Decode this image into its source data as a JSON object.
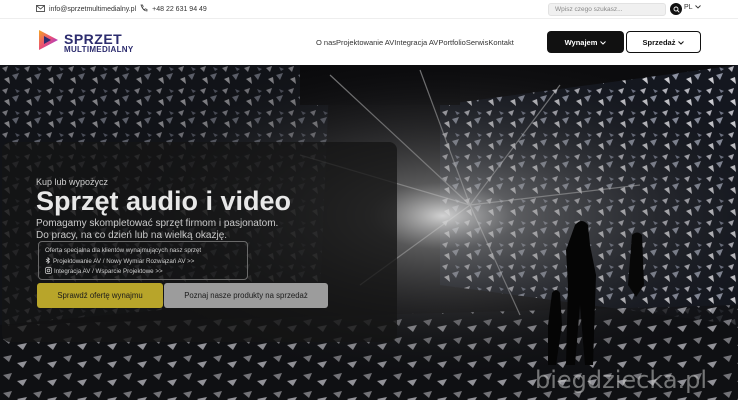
{
  "topbar": {
    "email": "info@sprzetmultimedialny.pl",
    "phone": "+48 22 631 94 49",
    "search_placeholder": "Wpisz czego szukasz...",
    "lang": "PL"
  },
  "logo": {
    "line1": "SPRZET",
    "line2": "MULTIMEDIALNY"
  },
  "nav": {
    "items": [
      "O nas",
      "Projektowanie AV",
      "Integracja AV",
      "Portfolio",
      "Serwis",
      "Kontakt"
    ],
    "rent_label": "Wynajem",
    "sale_label": "Sprzedaż"
  },
  "hero": {
    "kicker": "Kup lub wypożycz",
    "headline": "Sprzęt audio i video",
    "sub1": "Pomagamy skompletować sprzęt firmom i pasjonatom.",
    "sub2": "Do pracy, na co dzień lub na wielką okazję.",
    "offer_title": "Oferta specjalna dla klientów wynajmujących nasz sprzęt",
    "offer_link1": "Projektowanie AV / Nowy Wymiar Rozwiązań AV >>",
    "offer_link2": "Integracja AV / Wsparcie Projektowe >>",
    "cta_primary": "Sprawdź ofertę wynajmu",
    "cta_secondary": "Poznaj nasze produkty na sprzedaż"
  },
  "watermark": "biegdziecka.pl",
  "colors": {
    "accent": "#b8a52a",
    "dark": "#111111",
    "logo": "#2c2c6e"
  }
}
